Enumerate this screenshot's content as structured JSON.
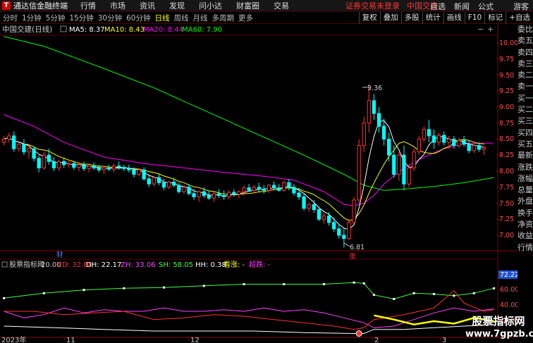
{
  "titlebar": {
    "app_name": "通达信金融终端",
    "menus": [
      "行情",
      "市场",
      "资讯",
      "发现",
      "问小达",
      "财富圈",
      "交易"
    ],
    "notice": "证券交易未登录",
    "stock_link": "中国交建",
    "right_items": [
      "自选",
      "新闻",
      "公式",
      "游客"
    ]
  },
  "toolbar": {
    "periods": [
      "分时",
      "1分钟",
      "5分钟",
      "15分钟",
      "30分钟",
      "60分钟",
      "日线",
      "周线",
      "月线",
      "多周期",
      "更多"
    ],
    "active_period": "日线",
    "tools": [
      "复权",
      "叠加",
      "多股",
      "统计",
      "画线",
      "F10",
      "标记",
      "+自选"
    ]
  },
  "main_chart": {
    "title": "中国交建(日线)",
    "ma_labels": [
      {
        "text": "MA5: 8.37",
        "color": "#ffffff"
      },
      {
        "text": "MA10: 8.43",
        "color": "#ffff00"
      },
      {
        "text": "MA20: 8.44",
        "color": "#ff00ff"
      },
      {
        "text": "MA60: 7.90",
        "color": "#00ff00"
      }
    ],
    "y_ticks": [
      "10.00",
      "9.75",
      "9.50",
      "9.25",
      "9.00",
      "8.75",
      "8.50",
      "8.25",
      "8.00",
      "7.75",
      "7.50",
      "7.25",
      "7.00"
    ],
    "high_label": "9.36",
    "low_label": "6.81",
    "event_marker": "财",
    "signal_marker": "涨"
  },
  "indicator": {
    "name": "股票指标网",
    "param": "20.00",
    "values": [
      {
        "text": "CD: 32.88",
        "color": "#ff3030"
      },
      {
        "text": "DH: 22.17",
        "color": "#ffffff"
      },
      {
        "text": "ZH: 33.06",
        "color": "#ff40ff"
      },
      {
        "text": "SH: 58.05",
        "color": "#40ff40"
      },
      {
        "text": "HH: 0.38",
        "color": "#ffffff"
      },
      {
        "text": "看涨: -",
        "color": "#ffff00"
      },
      {
        "text": "超跌: -",
        "color": "#ff40ff"
      }
    ],
    "y_ticks": [
      "60.00",
      "40.00",
      "20.00"
    ],
    "current_value": "72.22"
  },
  "x_axis": {
    "labels": [
      "2023年",
      "11",
      "12",
      "2",
      "3"
    ]
  },
  "side_panel": {
    "items": [
      "委比",
      "卖五",
      "卖四",
      "卖三",
      "卖二",
      "卖一",
      "买一",
      "买二",
      "买三",
      "买四",
      "买五",
      "最新",
      "涨跌",
      "涨幅",
      "总量",
      "外盘",
      "换手",
      "净资",
      "收益",
      "行情"
    ]
  },
  "watermark": {
    "line1": "股票指标网",
    "line2": "www.7gpzb.com"
  },
  "colors": {
    "up": "#ff3232",
    "down": "#00ffff",
    "ma5": "#ffffff",
    "ma10": "#ffff00",
    "ma20": "#ff00ff",
    "ma60": "#00ff00",
    "grid": "#5a0000"
  },
  "chart_data": {
    "type": "candlestick",
    "price_range": [
      6.75,
      10.2
    ],
    "indicator_range": [
      0,
      78
    ],
    "candles": [
      [
        8.45,
        8.55,
        8.4,
        8.5
      ],
      [
        8.5,
        8.6,
        8.45,
        8.55
      ],
      [
        8.55,
        8.62,
        8.3,
        8.35
      ],
      [
        8.35,
        8.45,
        8.3,
        8.42
      ],
      [
        8.42,
        8.5,
        8.25,
        8.3
      ],
      [
        8.3,
        8.4,
        8.2,
        8.35
      ],
      [
        8.35,
        8.38,
        8.15,
        8.2
      ],
      [
        8.2,
        8.25,
        7.98,
        8.05
      ],
      [
        8.05,
        8.3,
        8.02,
        8.25
      ],
      [
        8.25,
        8.35,
        8.1,
        8.15
      ],
      [
        8.15,
        8.22,
        8.0,
        8.05
      ],
      [
        8.05,
        8.18,
        8.0,
        8.15
      ],
      [
        8.15,
        8.2,
        8.05,
        8.1
      ],
      [
        8.1,
        8.18,
        8.05,
        8.12
      ],
      [
        8.12,
        8.16,
        8.02,
        8.06
      ],
      [
        8.06,
        8.14,
        8.0,
        8.1
      ],
      [
        8.1,
        8.15,
        8.0,
        8.04
      ],
      [
        8.04,
        8.12,
        7.98,
        8.08
      ],
      [
        8.08,
        8.14,
        8.02,
        8.05
      ],
      [
        8.05,
        8.1,
        7.98,
        8.02
      ],
      [
        8.02,
        8.08,
        7.95,
        8.05
      ],
      [
        8.05,
        8.1,
        8.0,
        8.03
      ],
      [
        8.03,
        8.12,
        7.98,
        8.08
      ],
      [
        8.08,
        8.15,
        8.02,
        8.06
      ],
      [
        8.06,
        8.1,
        8.0,
        8.04
      ],
      [
        8.04,
        8.1,
        7.98,
        8.02
      ],
      [
        8.02,
        8.06,
        7.9,
        7.95
      ],
      [
        7.95,
        8.05,
        7.92,
        8.02
      ],
      [
        8.02,
        8.06,
        7.85,
        7.88
      ],
      [
        7.88,
        7.95,
        7.75,
        7.8
      ],
      [
        7.8,
        7.92,
        7.76,
        7.9
      ],
      [
        7.9,
        7.95,
        7.78,
        7.82
      ],
      [
        7.82,
        7.88,
        7.7,
        7.75
      ],
      [
        7.75,
        7.85,
        7.72,
        7.83
      ],
      [
        7.83,
        7.9,
        7.75,
        7.78
      ],
      [
        7.78,
        7.82,
        7.65,
        7.68
      ],
      [
        7.68,
        7.78,
        7.64,
        7.75
      ],
      [
        7.75,
        7.8,
        7.62,
        7.65
      ],
      [
        7.65,
        7.72,
        7.55,
        7.6
      ],
      [
        7.6,
        7.7,
        7.52,
        7.68
      ],
      [
        7.68,
        7.75,
        7.58,
        7.62
      ],
      [
        7.62,
        7.7,
        7.55,
        7.58
      ],
      [
        7.58,
        7.68,
        7.52,
        7.65
      ],
      [
        7.65,
        7.72,
        7.58,
        7.62
      ],
      [
        7.62,
        7.7,
        7.55,
        7.6
      ],
      [
        7.6,
        7.7,
        7.56,
        7.67
      ],
      [
        7.67,
        7.72,
        7.6,
        7.64
      ],
      [
        7.64,
        7.7,
        7.58,
        7.68
      ],
      [
        7.68,
        7.78,
        7.62,
        7.74
      ],
      [
        7.74,
        7.8,
        7.68,
        7.7
      ],
      [
        7.7,
        7.78,
        7.65,
        7.75
      ],
      [
        7.75,
        7.82,
        7.68,
        7.72
      ],
      [
        7.72,
        7.78,
        7.65,
        7.7
      ],
      [
        7.7,
        7.8,
        7.66,
        7.78
      ],
      [
        7.78,
        7.84,
        7.7,
        7.74
      ],
      [
        7.74,
        7.8,
        7.68,
        7.7
      ],
      [
        7.7,
        7.85,
        7.68,
        7.82
      ],
      [
        7.82,
        7.88,
        7.7,
        7.75
      ],
      [
        7.75,
        7.8,
        7.62,
        7.66
      ],
      [
        7.66,
        7.74,
        7.55,
        7.6
      ],
      [
        7.6,
        7.66,
        7.38,
        7.42
      ],
      [
        7.42,
        7.52,
        7.36,
        7.48
      ],
      [
        7.48,
        7.55,
        7.35,
        7.4
      ],
      [
        7.4,
        7.45,
        7.22,
        7.25
      ],
      [
        7.25,
        7.35,
        7.18,
        7.3
      ],
      [
        7.3,
        7.36,
        7.15,
        7.2
      ],
      [
        7.2,
        7.28,
        7.05,
        7.1
      ],
      [
        7.1,
        7.18,
        6.95,
        7.0
      ],
      [
        7.0,
        7.12,
        6.81,
        6.95
      ],
      [
        6.95,
        7.25,
        6.92,
        7.2
      ],
      [
        7.2,
        7.6,
        7.18,
        7.55
      ],
      [
        7.55,
        8.5,
        7.5,
        8.4
      ],
      [
        8.4,
        8.85,
        8.3,
        8.75
      ],
      [
        8.75,
        9.36,
        8.6,
        9.1
      ],
      [
        9.1,
        9.2,
        8.8,
        8.9
      ],
      [
        8.9,
        9.0,
        8.6,
        8.7
      ],
      [
        8.7,
        8.82,
        8.4,
        8.5
      ],
      [
        8.5,
        8.6,
        8.15,
        8.25
      ],
      [
        8.25,
        8.4,
        7.9,
        7.95
      ],
      [
        7.95,
        8.3,
        7.85,
        8.25
      ],
      [
        8.25,
        8.4,
        7.7,
        7.8
      ],
      [
        7.8,
        8.1,
        7.75,
        8.05
      ],
      [
        8.05,
        8.35,
        8.0,
        8.3
      ],
      [
        8.3,
        8.55,
        8.25,
        8.5
      ],
      [
        8.5,
        8.7,
        8.45,
        8.65
      ],
      [
        8.65,
        8.8,
        8.45,
        8.55
      ],
      [
        8.55,
        8.65,
        8.35,
        8.45
      ],
      [
        8.45,
        8.6,
        8.4,
        8.56
      ],
      [
        8.56,
        8.62,
        8.4,
        8.45
      ],
      [
        8.45,
        8.55,
        8.35,
        8.5
      ],
      [
        8.5,
        8.55,
        8.35,
        8.4
      ],
      [
        8.4,
        8.52,
        8.36,
        8.48
      ],
      [
        8.48,
        8.55,
        8.38,
        8.42
      ],
      [
        8.42,
        8.48,
        8.28,
        8.32
      ],
      [
        8.32,
        8.45,
        8.28,
        8.4
      ],
      [
        8.4,
        8.45,
        8.3,
        8.34
      ],
      [
        8.34,
        8.4,
        8.25,
        8.37
      ]
    ],
    "ma60_points": [
      [
        0,
        10.1
      ],
      [
        8,
        9.95
      ],
      [
        20,
        9.6
      ],
      [
        30,
        9.3
      ],
      [
        40,
        8.95
      ],
      [
        50,
        8.6
      ],
      [
        60,
        8.25
      ],
      [
        68,
        7.95
      ],
      [
        72,
        7.78
      ],
      [
        76,
        7.7
      ],
      [
        80,
        7.72
      ],
      [
        86,
        7.76
      ],
      [
        92,
        7.82
      ],
      [
        98,
        7.9
      ]
    ],
    "ma20_points": [
      [
        0,
        8.88
      ],
      [
        6,
        8.7
      ],
      [
        12,
        8.45
      ],
      [
        20,
        8.22
      ],
      [
        28,
        8.12
      ],
      [
        36,
        8.05
      ],
      [
        44,
        7.98
      ],
      [
        52,
        7.92
      ],
      [
        58,
        7.86
      ],
      [
        64,
        7.68
      ],
      [
        68,
        7.48
      ],
      [
        70,
        7.46
      ],
      [
        72,
        7.5
      ],
      [
        74,
        7.62
      ],
      [
        76,
        7.8
      ],
      [
        80,
        8.05
      ],
      [
        84,
        8.22
      ],
      [
        88,
        8.35
      ],
      [
        92,
        8.43
      ],
      [
        98,
        8.44
      ]
    ],
    "indicator_series": [
      {
        "name": "SH",
        "color": "#40ff40",
        "points": [
          [
            0,
            46
          ],
          [
            8,
            52
          ],
          [
            16,
            56
          ],
          [
            24,
            58
          ],
          [
            32,
            59
          ],
          [
            40,
            61
          ],
          [
            48,
            63
          ],
          [
            56,
            63
          ],
          [
            64,
            63
          ],
          [
            70,
            65
          ],
          [
            72,
            64
          ],
          [
            74,
            50
          ],
          [
            78,
            45
          ],
          [
            82,
            52
          ],
          [
            86,
            51
          ],
          [
            90,
            49
          ],
          [
            94,
            52
          ],
          [
            98,
            58
          ]
        ]
      },
      {
        "name": "ZH",
        "color": "#ff40ff",
        "points": [
          [
            0,
            30
          ],
          [
            4,
            22
          ],
          [
            8,
            26
          ],
          [
            12,
            34
          ],
          [
            16,
            28
          ],
          [
            20,
            32
          ],
          [
            24,
            30
          ],
          [
            28,
            30
          ],
          [
            32,
            34
          ],
          [
            36,
            30
          ],
          [
            40,
            30
          ],
          [
            44,
            32
          ],
          [
            48,
            30
          ],
          [
            52,
            34
          ],
          [
            56,
            30
          ],
          [
            60,
            32
          ],
          [
            64,
            28
          ],
          [
            68,
            22
          ],
          [
            72,
            16
          ],
          [
            74,
            10
          ],
          [
            78,
            12
          ],
          [
            82,
            20
          ],
          [
            86,
            28
          ],
          [
            90,
            34
          ],
          [
            94,
            30
          ],
          [
            98,
            33
          ]
        ]
      },
      {
        "name": "CD",
        "color": "#ff3030",
        "points": [
          [
            0,
            30
          ],
          [
            6,
            30
          ],
          [
            12,
            26
          ],
          [
            18,
            28
          ],
          [
            24,
            30
          ],
          [
            30,
            20
          ],
          [
            36,
            22
          ],
          [
            42,
            26
          ],
          [
            48,
            24
          ],
          [
            54,
            20
          ],
          [
            60,
            16
          ],
          [
            66,
            12
          ],
          [
            70,
            8
          ],
          [
            72,
            10
          ],
          [
            74,
            20
          ],
          [
            80,
            26
          ],
          [
            86,
            34
          ],
          [
            90,
            55
          ],
          [
            92,
            40
          ],
          [
            96,
            30
          ],
          [
            98,
            32
          ]
        ]
      },
      {
        "name": "DH",
        "color": "#ffffff",
        "points": [
          [
            0,
            12
          ],
          [
            10,
            10
          ],
          [
            20,
            8
          ],
          [
            30,
            6
          ],
          [
            40,
            6
          ],
          [
            50,
            6
          ],
          [
            60,
            4
          ],
          [
            70,
            3
          ],
          [
            72,
            3
          ],
          [
            74,
            8
          ],
          [
            80,
            8
          ],
          [
            86,
            10
          ],
          [
            92,
            12
          ],
          [
            98,
            14
          ]
        ]
      },
      {
        "name": "看涨",
        "color": "#ffff00",
        "points": [
          [
            74,
            25
          ],
          [
            78,
            20
          ],
          [
            82,
            14
          ],
          [
            86,
            18
          ],
          [
            90,
            15
          ],
          [
            94,
            22
          ],
          [
            98,
            18
          ]
        ]
      }
    ]
  }
}
